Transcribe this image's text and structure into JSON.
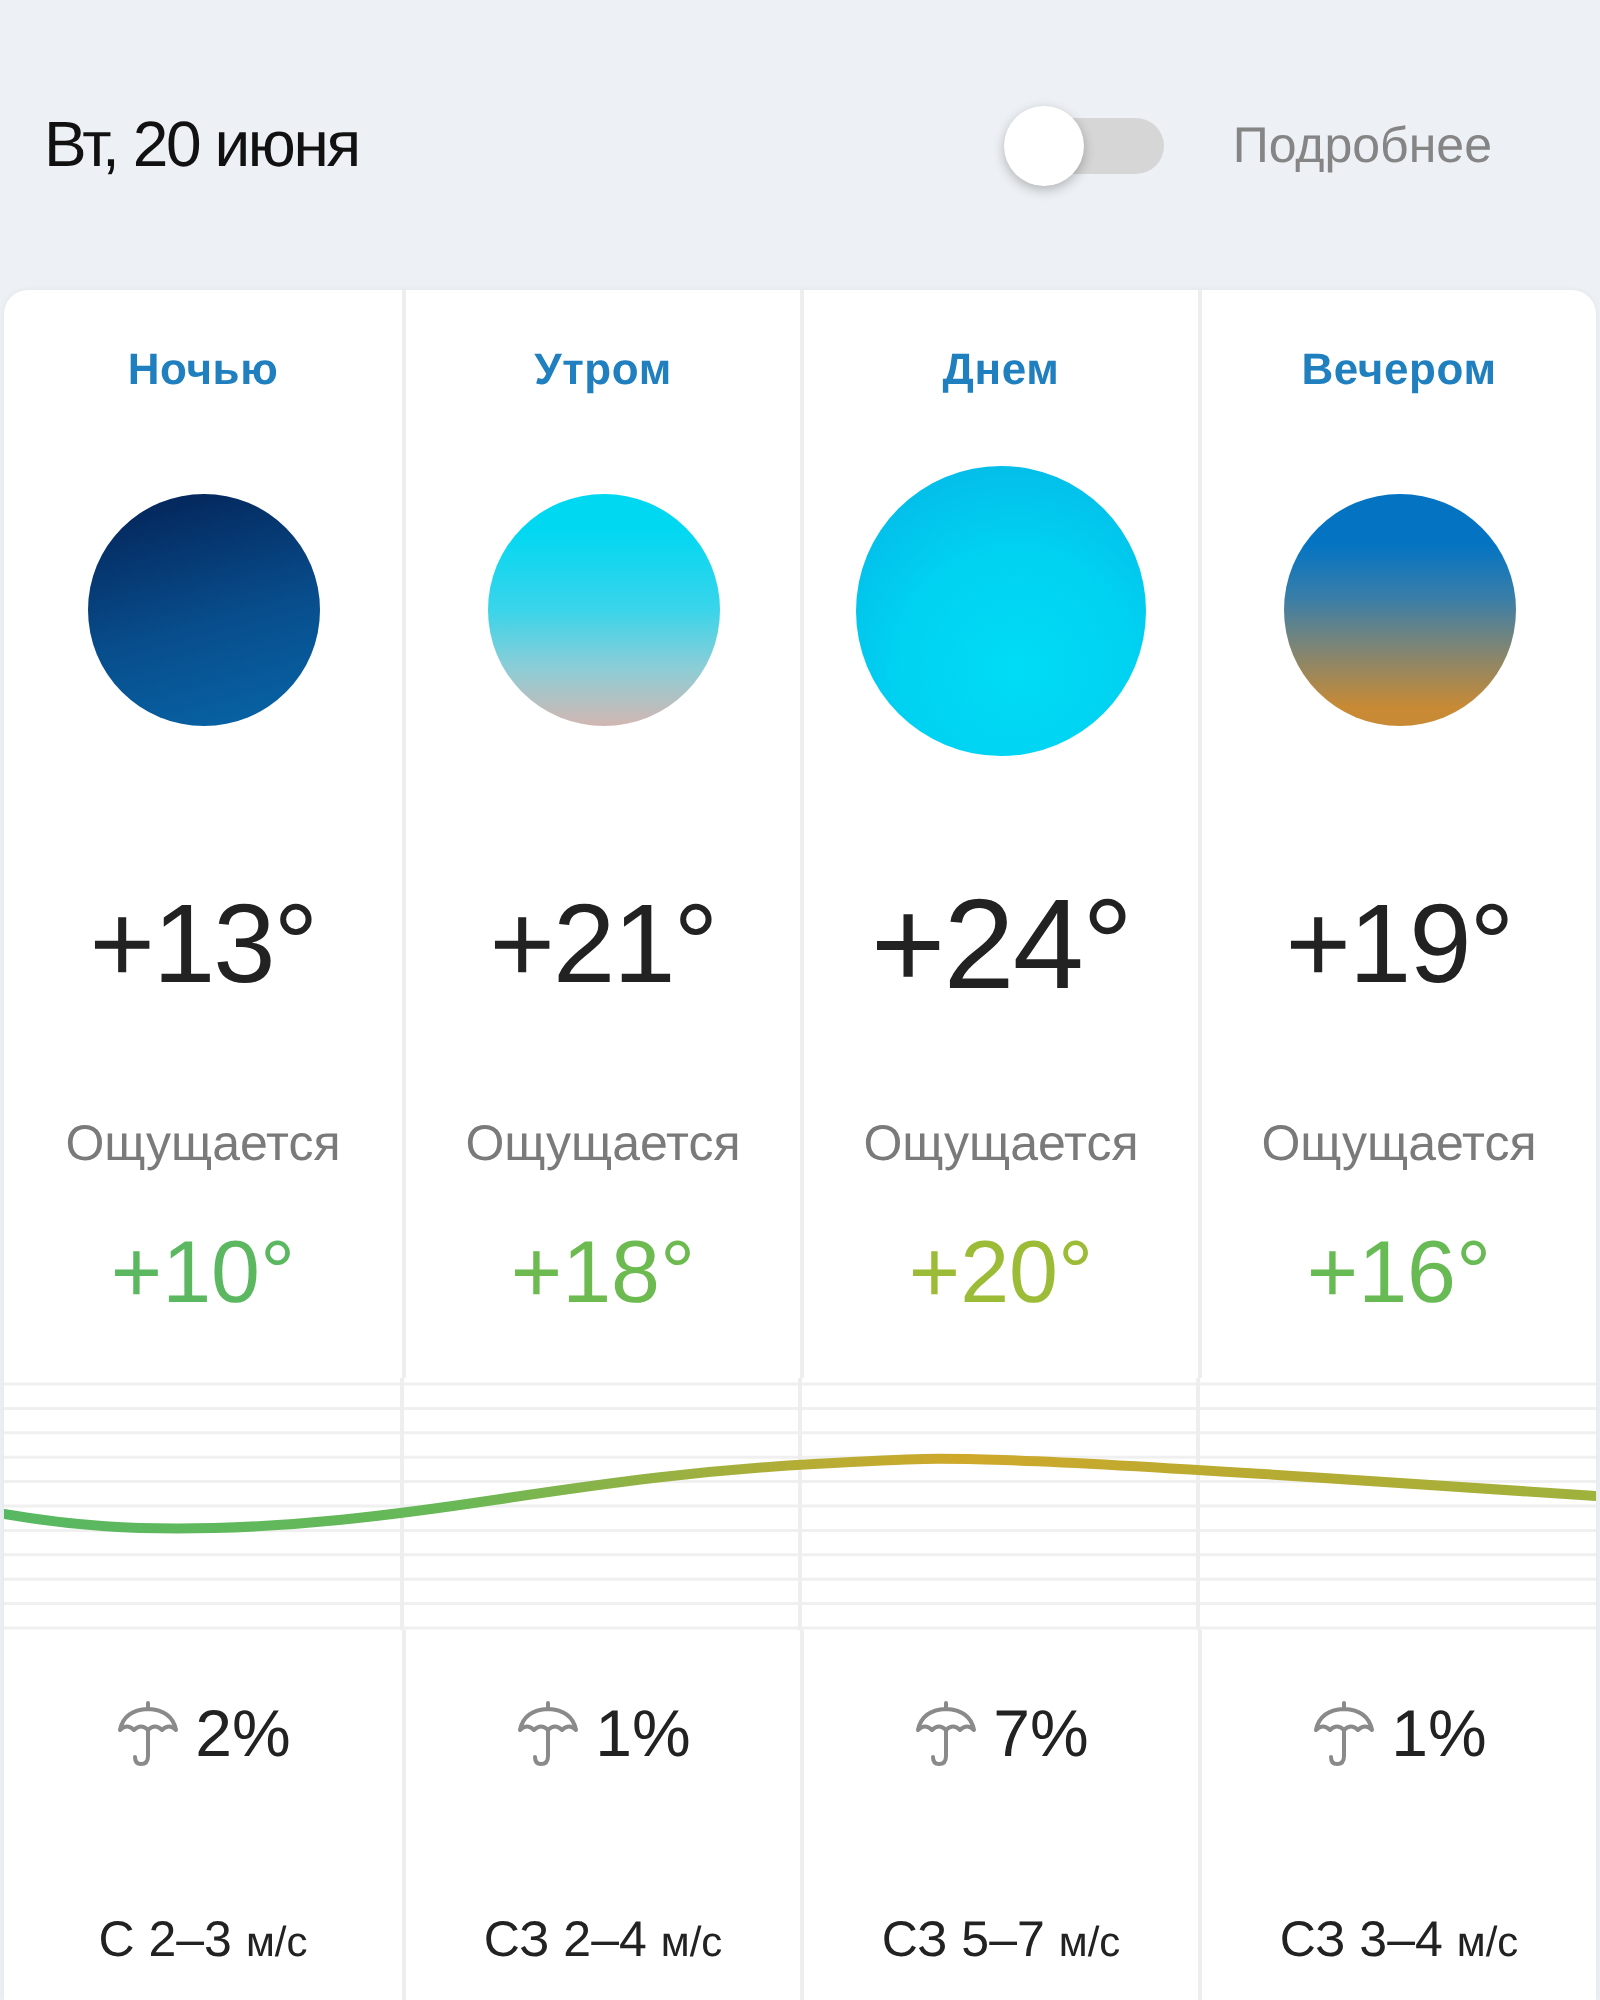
{
  "header": {
    "date": "Вт, 20 июня",
    "toggle": {
      "label": "Подробнее",
      "on": false
    }
  },
  "periods": [
    {
      "kind": "night",
      "label": "Ночью",
      "temperature": "+13°",
      "feels_label": "Ощущается",
      "feels": "+10°",
      "color": "#5cb860",
      "precipitation": "2%",
      "wind": "С 2–3",
      "wind_unit": "м/с"
    },
    {
      "kind": "morning",
      "label": "Утром",
      "temperature": "+21°",
      "feels_label": "Ощущается",
      "feels": "+18°",
      "color": "#6cba50",
      "precipitation": "1%",
      "wind": "СЗ 2–4",
      "wind_unit": "м/с"
    },
    {
      "kind": "day",
      "label": "Днем",
      "temperature": "+24°",
      "feels_label": "Ощущается",
      "feels": "+20°",
      "color": "#9cbb36",
      "precipitation": "7%",
      "wind": "СЗ 5–7",
      "wind_unit": "м/с"
    },
    {
      "kind": "evening",
      "label": "Вечером",
      "temperature": "+19°",
      "feels_label": "Ощущается",
      "feels": "+16°",
      "color": "#68ba55",
      "precipitation": "1%",
      "wind": "СЗ 3–4",
      "wind_unit": "м/с"
    }
  ]
}
